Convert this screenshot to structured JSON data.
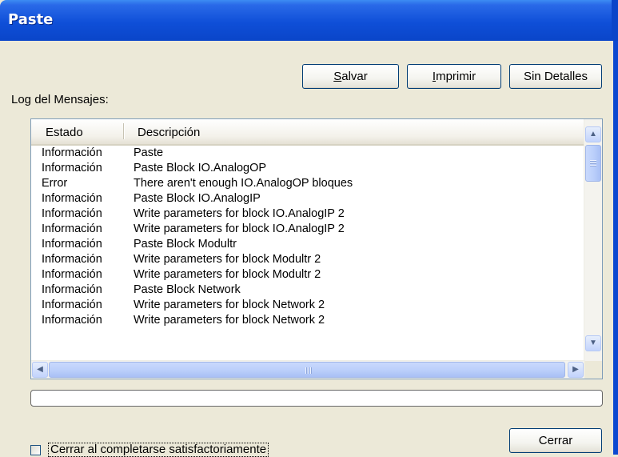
{
  "window": {
    "title": "Paste"
  },
  "toolbar": {
    "save_label_accel": "S",
    "save_label_rest": "alvar",
    "print_label_accel": "I",
    "print_label_rest": "mprimir",
    "details_label": "Sin Detalles"
  },
  "log": {
    "label": "Log del Mensajes:",
    "columns": [
      "Estado",
      "Descripción"
    ],
    "rows": [
      {
        "estado": "Información",
        "descripcion": "Paste"
      },
      {
        "estado": "Información",
        "descripcion": "Paste Block IO.AnalogOP"
      },
      {
        "estado": "Error",
        "descripcion": "There aren't enough IO.AnalogOP bloques"
      },
      {
        "estado": "Información",
        "descripcion": "Paste Block IO.AnalogIP"
      },
      {
        "estado": "Información",
        "descripcion": "Write parameters for block IO.AnalogIP 2"
      },
      {
        "estado": "Información",
        "descripcion": "Write parameters for block IO.AnalogIP 2"
      },
      {
        "estado": "Información",
        "descripcion": "Paste Block Modultr"
      },
      {
        "estado": "Información",
        "descripcion": "Write parameters for block Modultr 2"
      },
      {
        "estado": "Información",
        "descripcion": "Write parameters for block Modultr 2"
      },
      {
        "estado": "Información",
        "descripcion": "Paste Block Network"
      },
      {
        "estado": "Información",
        "descripcion": "Write parameters for block Network 2"
      },
      {
        "estado": "Información",
        "descripcion": "Write parameters for block Network 2"
      }
    ]
  },
  "footer": {
    "close_label": "Cerrar",
    "auto_close_label": "Cerrar al completarse satisfactoriamente",
    "auto_close_checked": false
  },
  "progress": {
    "value": 0
  }
}
